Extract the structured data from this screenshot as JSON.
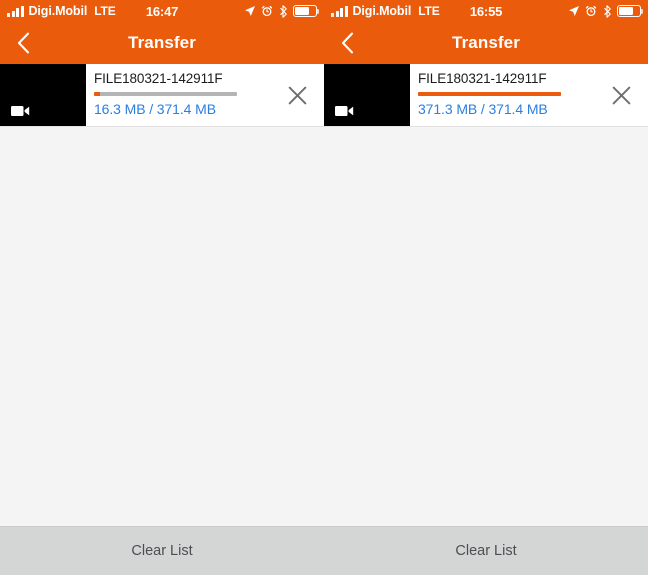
{
  "theme": {
    "accent": "#ea5b0c",
    "link_blue": "#2a7fe0",
    "toolbar_bg": "#d4d6d6",
    "body_bg": "#f4f4f4",
    "thumb_bg": "#000000",
    "track_gray": "#b5b5b5"
  },
  "panels": [
    {
      "status_bar": {
        "carrier": "Digi.Mobil",
        "network": "LTE",
        "time": "16:47",
        "signal_bars_filled": 4,
        "battery_percent": 62,
        "icons": [
          "signal-bars-icon",
          "location-arrow-icon",
          "alarm-clock-icon",
          "bluetooth-icon",
          "battery-icon"
        ]
      },
      "nav": {
        "back_icon": "chevron-left-icon",
        "title": "Transfer"
      },
      "transfer": {
        "thumbnail_icon": "video-camera-icon",
        "file_name": "FILE180321-142911F",
        "progress_percent": 4.4,
        "transferred": "16.3 MB",
        "separator": "/",
        "total": "371.4 MB",
        "size_text": "16.3 MB / 371.4 MB",
        "close_icon": "close-icon"
      },
      "toolbar": {
        "clear_label": "Clear List"
      }
    },
    {
      "status_bar": {
        "carrier": "Digi.Mobil",
        "network": "LTE",
        "time": "16:55",
        "signal_bars_filled": 4,
        "battery_percent": 62,
        "icons": [
          "signal-bars-icon",
          "location-arrow-icon",
          "alarm-clock-icon",
          "bluetooth-icon",
          "battery-icon"
        ]
      },
      "nav": {
        "back_icon": "chevron-left-icon",
        "title": "Transfer"
      },
      "transfer": {
        "thumbnail_icon": "video-camera-icon",
        "file_name": "FILE180321-142911F",
        "progress_percent": 99.97,
        "transferred": "371.3 MB",
        "separator": "/",
        "total": "371.4 MB",
        "size_text": "371.3 MB / 371.4 MB",
        "close_icon": "close-icon"
      },
      "toolbar": {
        "clear_label": "Clear List"
      }
    }
  ]
}
